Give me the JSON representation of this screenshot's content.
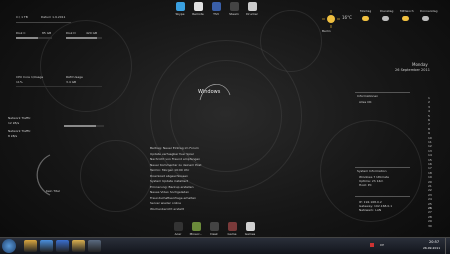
{
  "desktop": {
    "center_logo": "Windows",
    "top_dock": [
      {
        "label": "Skype",
        "color": "#3aa0e0"
      },
      {
        "label": "Remote",
        "color": "#e0e0e0"
      },
      {
        "label": "TS3",
        "color": "#3a5fa8"
      },
      {
        "label": "Steam",
        "color": "#444"
      },
      {
        "label": "Drucker",
        "color": "#ccc"
      }
    ],
    "bottom_dock": [
      {
        "label": "Acer",
        "color": "#333"
      },
      {
        "label": "Minecr...",
        "color": "#6a8a3a"
      },
      {
        "label": "Desk",
        "color": "#444"
      },
      {
        "label": "Game",
        "color": "#7a3a3a"
      },
      {
        "label": "Games",
        "color": "#d0d0d0"
      }
    ]
  },
  "left_widgets": {
    "panel1_header": [
      "C:\\ 1 TB",
      "Datum 1.9.2011"
    ],
    "drive1": {
      "label": "Disk C",
      "size": "85 GB",
      "fill": 0.6
    },
    "drive2": {
      "label": "Disk D",
      "size": "420 GB",
      "fill": 0.85
    },
    "cpu": {
      "label": "CPU Core 1/Usage",
      "value": "11%"
    },
    "ram": {
      "label": "RAM Usage",
      "value": "3.4 GB"
    },
    "net": {
      "label": "Network Traffic",
      "value": "12 kB/s"
    },
    "net2": {
      "label": "Network Traffic",
      "value": "8 kB/s"
    },
    "playing": "Kein Titel"
  },
  "weather": {
    "today_temp": "16°C",
    "days": [
      "Montag",
      "Dienstag",
      "Mittwoch",
      "Donnerstag"
    ],
    "city": "Berlin"
  },
  "date": {
    "weekday": "Monday",
    "date": "26 September 2011"
  },
  "right_panels": {
    "p1_title": "Informationen",
    "p1_text": "Alles OK",
    "p2_title": "System Information",
    "p2_lines": [
      "Windows 7 Ultimate",
      "Uptime: 2h 14m",
      "Host: PC"
    ],
    "p3_lines": [
      "IP: 192.168.0.2",
      "Gateway: 192.168.0.1",
      "Netzwerk: LAN"
    ]
  },
  "feed_lines": [
    "Beitrag: Neuer Eintrag im Forum",
    "Update verfuegbar fuer Spiel",
    "Nachricht von Freund empfangen",
    "Neuer Kommentar zu deinem Post",
    "Termin: Morgen 10:00 Uhr",
    "Download abgeschlossen",
    "System Update installiert",
    "Erinnerung: Backup erstellen",
    "Neues Video hochgeladen",
    "Freundschaftsanfrage erhalten",
    "Server wieder online",
    "Wochenbericht erstellt"
  ],
  "calendar_days": [
    "1",
    "2",
    "3",
    "4",
    "5",
    "6",
    "7",
    "8",
    "9",
    "10",
    "11",
    "12",
    "13",
    "14",
    "15",
    "16",
    "17",
    "18",
    "19",
    "20",
    "21",
    "22",
    "23",
    "24",
    "25",
    "26",
    "27",
    "28",
    "29",
    "30"
  ],
  "taskbar": {
    "apps": [
      {
        "name": "explorer",
        "color": "#d9a640"
      },
      {
        "name": "chrome",
        "color": "#4a8fdc"
      },
      {
        "name": "media",
        "color": "#3a6fd0"
      },
      {
        "name": "folder",
        "color": "#d9b050"
      },
      {
        "name": "generic",
        "color": "#5a6a80"
      }
    ],
    "time": "20:57",
    "date": "26.09.2011",
    "lang": "DE"
  },
  "colors": {
    "accent": "#8a8a8a",
    "background": "#0d0d0d"
  }
}
